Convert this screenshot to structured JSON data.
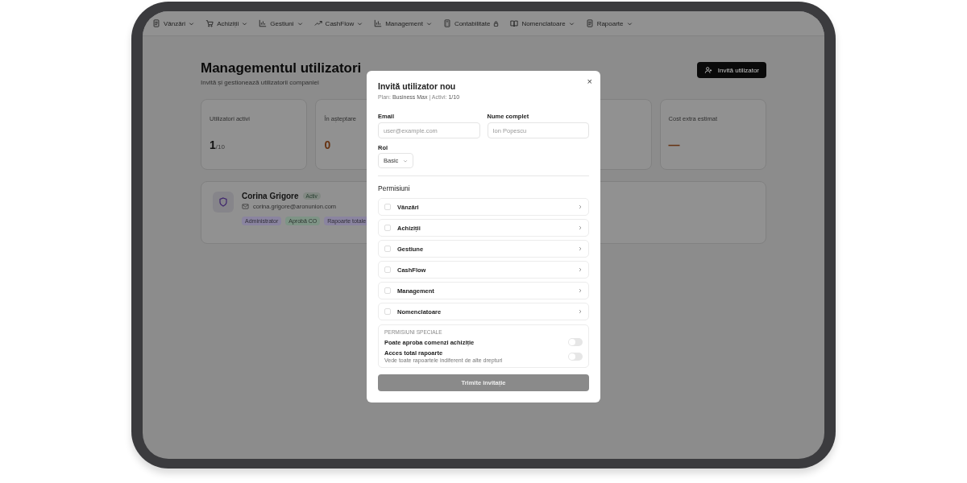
{
  "nav": [
    {
      "label": "Vânzări",
      "locked": false
    },
    {
      "label": "Achiziții",
      "locked": false
    },
    {
      "label": "Gestiuni",
      "locked": false
    },
    {
      "label": "CashFlow",
      "locked": false
    },
    {
      "label": "Management",
      "locked": false
    },
    {
      "label": "Contabilitate",
      "locked": true
    },
    {
      "label": "Nomenclatoare",
      "locked": false
    },
    {
      "label": "Rapoarte",
      "locked": false
    }
  ],
  "page": {
    "title": "Managementul utilizatori",
    "subtitle": "Invită și gestionează utilizatorii companiei",
    "invite_button": "Invită utilizator"
  },
  "stats": [
    {
      "label": "Utilizatori activi",
      "value": "1",
      "suffix": "/10",
      "color": "#121212"
    },
    {
      "label": "În așteptare",
      "value": "0",
      "color": "#663211"
    },
    {
      "label": "Cost extra estimat",
      "value": "—",
      "color": "#663211"
    }
  ],
  "user": {
    "name": "Corina Grigore",
    "status": "Activ",
    "email": "corina.grigore@aronunion.com",
    "tags": [
      {
        "label": "Administrator",
        "color": "#8a84a0"
      },
      {
        "label": "Aprobă CO",
        "color": "#7e9486"
      },
      {
        "label": "Rapoarte totale",
        "color": "#8a84a0"
      }
    ]
  },
  "modal": {
    "title": "Invită utilizator nou",
    "subtitle": "Plan: **Business Max** | Activi: **1/10**",
    "close": "×",
    "email": {
      "label": "Email",
      "placeholder": "user@example.com"
    },
    "name": {
      "label": "Nume complet",
      "placeholder": "Ion Popescu"
    },
    "role": {
      "label": "Rol",
      "value": "Basic"
    },
    "permissions_title": "Permisiuni",
    "permissions": [
      {
        "label": "Vânzări",
        "checked": false
      },
      {
        "label": "Achiziții",
        "checked": false
      },
      {
        "label": "Gestiune",
        "checked": false
      },
      {
        "label": "CashFlow",
        "checked": false
      },
      {
        "label": "Management",
        "checked": false
      },
      {
        "label": "Nomenclatoare",
        "checked": false
      }
    ],
    "special_title": "PERMISIUNI SPECIALE",
    "special": [
      {
        "label": "Poate aproba comenzi achiziție",
        "on": false
      },
      {
        "label": "Acces total rapoarte",
        "description": "Vede toate rapoartele indiferent de alte drepturi",
        "on": false
      }
    ],
    "submit": {
      "label": "Trimite invitație",
      "disabled": true
    }
  }
}
